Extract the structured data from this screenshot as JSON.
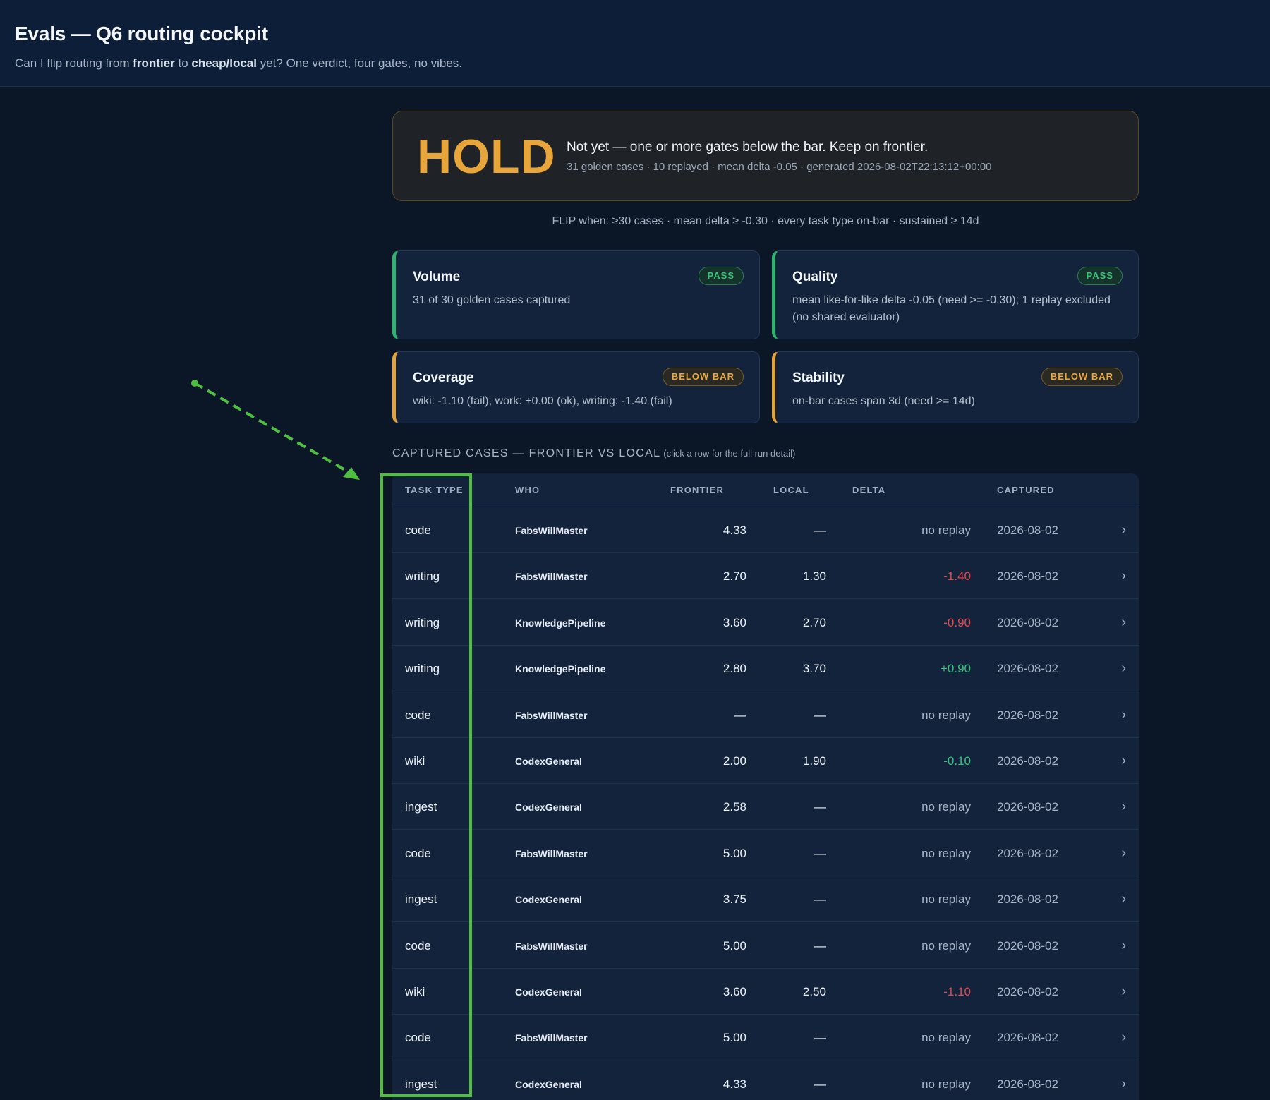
{
  "header": {
    "title": "Evals — Q6 routing cockpit",
    "subtitle_prefix": "Can I flip routing from ",
    "subtitle_from": "frontier",
    "subtitle_mid": " to ",
    "subtitle_to": "cheap/local",
    "subtitle_suffix": " yet? One verdict, four gates, no vibes."
  },
  "verdict": {
    "label": "HOLD",
    "message": "Not yet — one or more gates below the bar. Keep on frontier.",
    "meta": "31 golden cases · 10 replayed · mean delta -0.05 · generated 2026-08-02T22:13:12+00:00",
    "color": "#e8a53a"
  },
  "flip_rule": "FLIP when: ≥30 cases · mean delta ≥ -0.30 · every task type on-bar · sustained ≥ 14d",
  "gates": [
    {
      "name": "Volume",
      "status": "PASS",
      "detail": "31 of 30 golden cases captured"
    },
    {
      "name": "Quality",
      "status": "PASS",
      "detail": "mean like-for-like delta -0.05 (need >= -0.30); 1 replay excluded (no shared evaluator)"
    },
    {
      "name": "Coverage",
      "status": "BELOW BAR",
      "detail": "wiki: -1.10 (fail), work: +0.00 (ok), writing: -1.40 (fail)"
    },
    {
      "name": "Stability",
      "status": "BELOW BAR",
      "detail": "on-bar cases span 3d (need >= 14d)"
    }
  ],
  "status_colors": {
    "pass": "#2fb36e",
    "below": "#e3a23a",
    "negative": "#e5484d",
    "positive": "#35c27a"
  },
  "cases": {
    "title": "CAPTURED CASES — FRONTIER VS LOCAL",
    "hint": "(click a row for the full run detail)",
    "columns": [
      "TASK TYPE",
      "WHO",
      "FRONTIER",
      "LOCAL",
      "DELTA",
      "CAPTURED"
    ],
    "row_icon": "chevron-right-icon",
    "rows": [
      {
        "task": "code",
        "who": "FabsWillMaster",
        "frontier": "4.33",
        "local": "—",
        "delta": "no replay",
        "captured": "2026-08-02"
      },
      {
        "task": "writing",
        "who": "FabsWillMaster",
        "frontier": "2.70",
        "local": "1.30",
        "delta": "-1.40",
        "captured": "2026-08-02"
      },
      {
        "task": "writing",
        "who": "KnowledgePipeline",
        "frontier": "3.60",
        "local": "2.70",
        "delta": "-0.90",
        "captured": "2026-08-02"
      },
      {
        "task": "writing",
        "who": "KnowledgePipeline",
        "frontier": "2.80",
        "local": "3.70",
        "delta": "+0.90",
        "captured": "2026-08-02"
      },
      {
        "task": "code",
        "who": "FabsWillMaster",
        "frontier": "—",
        "local": "—",
        "delta": "no replay",
        "captured": "2026-08-02"
      },
      {
        "task": "wiki",
        "who": "CodexGeneral",
        "frontier": "2.00",
        "local": "1.90",
        "delta": "-0.10",
        "captured": "2026-08-02"
      },
      {
        "task": "ingest",
        "who": "CodexGeneral",
        "frontier": "2.58",
        "local": "—",
        "delta": "no replay",
        "captured": "2026-08-02"
      },
      {
        "task": "code",
        "who": "FabsWillMaster",
        "frontier": "5.00",
        "local": "—",
        "delta": "no replay",
        "captured": "2026-08-02"
      },
      {
        "task": "ingest",
        "who": "CodexGeneral",
        "frontier": "3.75",
        "local": "—",
        "delta": "no replay",
        "captured": "2026-08-02"
      },
      {
        "task": "code",
        "who": "FabsWillMaster",
        "frontier": "5.00",
        "local": "—",
        "delta": "no replay",
        "captured": "2026-08-02"
      },
      {
        "task": "wiki",
        "who": "CodexGeneral",
        "frontier": "3.60",
        "local": "2.50",
        "delta": "-1.10",
        "captured": "2026-08-02"
      },
      {
        "task": "code",
        "who": "FabsWillMaster",
        "frontier": "5.00",
        "local": "—",
        "delta": "no replay",
        "captured": "2026-08-02"
      },
      {
        "task": "ingest",
        "who": "CodexGeneral",
        "frontier": "4.33",
        "local": "—",
        "delta": "no replay",
        "captured": "2026-08-02"
      }
    ]
  },
  "annotation": {
    "color": "#4fbf42",
    "target": "task-type-column"
  }
}
